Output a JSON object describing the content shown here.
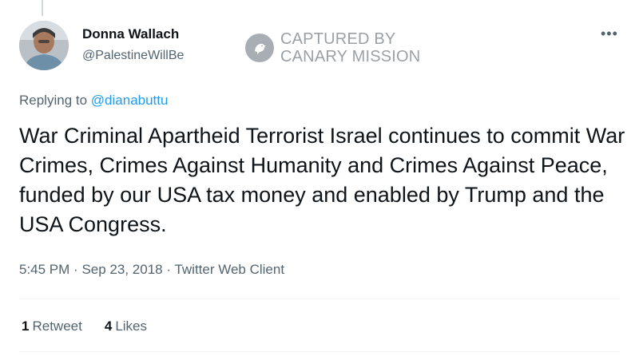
{
  "tweet": {
    "author": {
      "display_name": "Donna Wallach",
      "handle": "@PalestineWillBe"
    },
    "reply": {
      "prefix": "Replying to",
      "mention": "@dianabuttu"
    },
    "text": "War Criminal Apartheid Terrorist Israel continues to commit War Crimes, Crimes Against Humanity and Crimes Against Peace, funded by our USA tax money and enabled by Trump and the USA Congress.",
    "meta": {
      "time": "5:45 PM",
      "separator": "·",
      "date": "Sep 23, 2018",
      "client": "Twitter Web Client"
    },
    "stats": {
      "retweets_count": "1",
      "retweets_label": "Retweet",
      "likes_count": "4",
      "likes_label": "Likes"
    },
    "more_icon": "more-horizontal-icon"
  },
  "watermark": {
    "line1": "CAPTURED BY",
    "line2": "CANARY MISSION",
    "icon": "canary-bird-icon"
  },
  "colors": {
    "text_primary": "#0f1419",
    "text_secondary": "#536471",
    "link": "#1d9bf0",
    "divider": "#eff3f4",
    "watermark": "#8a9096"
  }
}
